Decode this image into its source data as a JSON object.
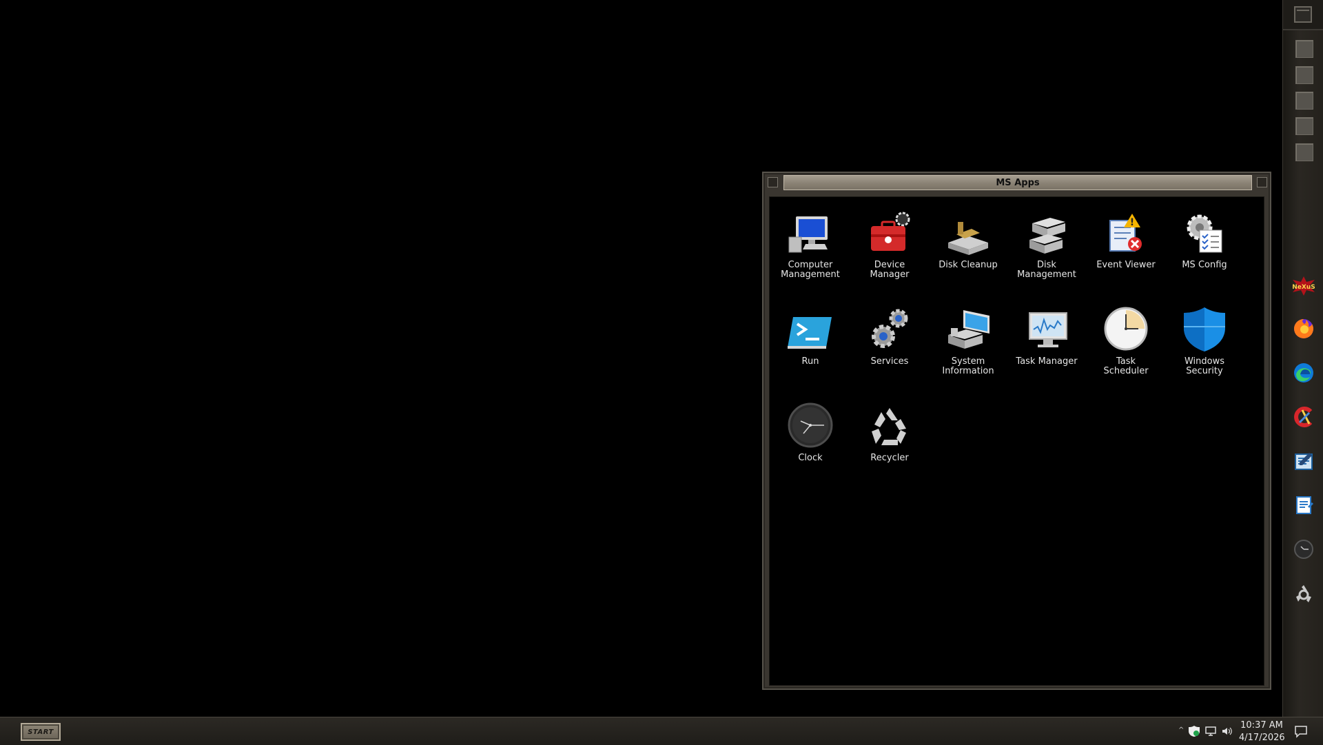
{
  "window": {
    "title": "MS Apps",
    "apps": [
      {
        "label": "Computer\nManagement",
        "icon": "computer-management-icon"
      },
      {
        "label": "Device\nManager",
        "icon": "device-manager-icon"
      },
      {
        "label": "Disk Cleanup",
        "icon": "disk-cleanup-icon"
      },
      {
        "label": "Disk\nManagement",
        "icon": "disk-management-icon"
      },
      {
        "label": "Event Viewer",
        "icon": "event-viewer-icon"
      },
      {
        "label": "MS Config",
        "icon": "ms-config-icon"
      },
      {
        "label": "Run",
        "icon": "run-icon"
      },
      {
        "label": "Services",
        "icon": "services-icon"
      },
      {
        "label": "System\nInformation",
        "icon": "system-information-icon"
      },
      {
        "label": "Task Manager",
        "icon": "task-manager-icon"
      },
      {
        "label": "Task\nScheduler",
        "icon": "task-scheduler-icon"
      },
      {
        "label": "Windows\nSecurity",
        "icon": "windows-security-icon"
      },
      {
        "label": "Clock",
        "icon": "clock-icon"
      },
      {
        "label": "Recycler",
        "icon": "recycler-icon"
      }
    ]
  },
  "dock": {
    "apps": [
      "nexus-icon",
      "firefox-icon",
      "edge-icon",
      "ccleaner-icon",
      "wordpad-icon",
      "notepad-icon",
      "clock-icon",
      "recycler-icon"
    ]
  },
  "taskbar": {
    "start_label": "START",
    "time": "10:37 AM",
    "date": "4/17/2026",
    "tray_chevron": "^"
  },
  "colors": {
    "desktop": "#000000",
    "frame": "#3a3630",
    "title_bar": "#8a8275"
  }
}
